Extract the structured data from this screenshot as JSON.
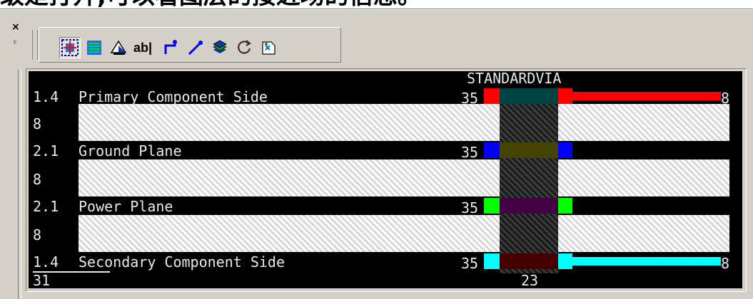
{
  "header": {
    "caption": "级是打开,可以看图层的接近场的信息。"
  },
  "window": {
    "close_label": "×"
  },
  "toolbar": {
    "buttons": [
      {
        "icon": "select-area-icon",
        "pressed": true
      },
      {
        "icon": "layer-stack-icon",
        "pressed": false
      },
      {
        "icon": "shape-fill-icon",
        "pressed": false
      },
      {
        "icon": "text-label-icon",
        "label": "ab|",
        "pressed": false
      },
      {
        "icon": "route-step-icon",
        "pressed": false
      },
      {
        "icon": "diagonal-route-icon",
        "pressed": false
      },
      {
        "icon": "layers-icon",
        "pressed": false
      },
      {
        "icon": "refresh-icon",
        "pressed": false
      },
      {
        "icon": "export-icon",
        "pressed": false
      }
    ]
  },
  "stackup": {
    "via_name": "STANDARDVIA",
    "layers": [
      {
        "thickness": "1.4",
        "name": "Primary Component Side",
        "width_value": "35",
        "right_value": "8",
        "color": "#ff0000",
        "via_fill": "#004444"
      },
      {
        "dielectric": "8"
      },
      {
        "thickness": "2.1",
        "name": "Ground Plane",
        "width_value": "35",
        "color": "#0000ff",
        "via_fill": "#444400"
      },
      {
        "dielectric": "8"
      },
      {
        "thickness": "2.1",
        "name": "Power Plane",
        "width_value": "35",
        "color": "#00ff00",
        "via_fill": "#440044"
      },
      {
        "dielectric": "8"
      },
      {
        "thickness": "1.4",
        "name": "Secondary Component Side",
        "width_value": "35",
        "right_value": "8",
        "color": "#00ffff",
        "via_fill": "#440000"
      }
    ],
    "total_thickness": "31",
    "via_width": "23"
  }
}
